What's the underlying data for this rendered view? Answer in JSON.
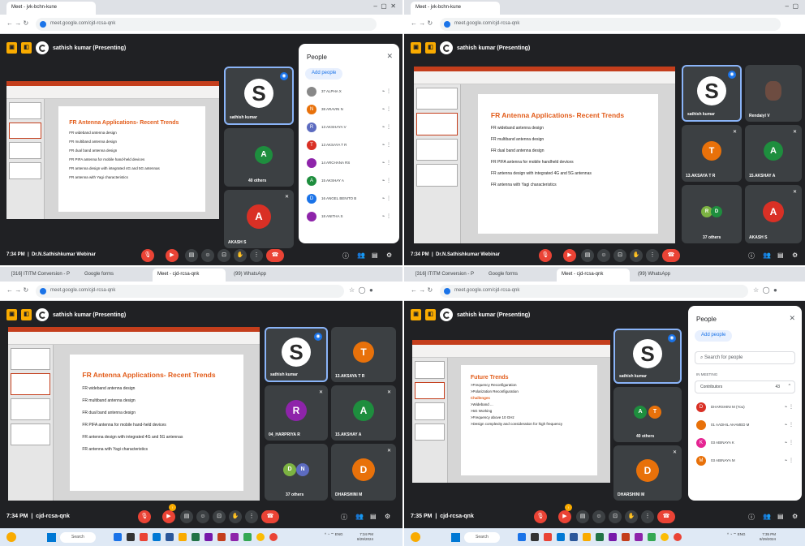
{
  "q1": {
    "tab": "Meet - jvk-bchn-kune",
    "url": "meet.google.com/cjd-rcsa-qnk",
    "presenter": "sathish kumar (Presenting)",
    "slide_title": "FR Antenna Applications- Recent Trends",
    "bullets": [
      "FR wideband antenna design",
      "FR multiband antenna design",
      "FR dual band antenna design",
      "FR PIFA antenna for mobile hand-held devices",
      "FR antenna design with integrated 4G and 5G antennas",
      "FR antenna with Yagi characteristics"
    ],
    "tiles": {
      "main": "sathish kumar",
      "others": "40 others",
      "akash": "AKASH S",
      "akash_initial": "A",
      "others_initial": "A"
    },
    "time": "7:34 PM",
    "meeting": "Dr.N.Sathishkumar Webinar",
    "people": {
      "title": "People",
      "add": "Add people",
      "rows": [
        {
          "name": "37 ALPHA X",
          "initial": "",
          "color": "#888888"
        },
        {
          "name": "38 ARAVIN N",
          "initial": "N",
          "color": "#e8710a"
        },
        {
          "name": "13 AKSHAYA V",
          "initial": "R",
          "color": "#5c6bc0"
        },
        {
          "name": "13 AKSAYA T R",
          "initial": "T",
          "color": "#d93025"
        },
        {
          "name": "14 ARCHANA RS",
          "initial": "",
          "color": "#8e24aa"
        },
        {
          "name": "15 AKSHAY A",
          "initial": "A",
          "color": "#1e8e3e"
        },
        {
          "name": "16 ANGEL BENITO B",
          "initial": "D",
          "color": "#1a73e8"
        },
        {
          "name": "18 ANITHA S",
          "initial": "",
          "color": "#8e24aa"
        }
      ]
    }
  },
  "q2": {
    "tab": "Meet - jvk-bchn-kune",
    "url": "meet.google.com/cjd-rcsa-qnk",
    "presenter": "sathish kumar (Presenting)",
    "slide_title": "FR Antenna Applications- Recent Trends",
    "bullets": [
      "FR wideband antenna design",
      "FR multiband antenna design",
      "FR dual band antenna design",
      "FR PIFA antenna for mobile handheld devices",
      "FR antenna design with integrated 4G and 5G antennas",
      "FR antenna with Yagi characteristics"
    ],
    "tiles": {
      "main": "sathish kumar",
      "t2": "Rendaiyl V",
      "t3": "13.AKSAYA T R",
      "t3i": "T",
      "t4": "15.AKSHAY A",
      "t4i": "A",
      "t5": "37 others",
      "t5a": "R",
      "t5b": "D",
      "t6": "AKASH S",
      "t6i": "A"
    },
    "time": "7:34 PM",
    "meeting": "Dr.N.Sathishkumar Webinar"
  },
  "q3": {
    "tabs": [
      "[316] ITITM Conversion - P",
      "Google forms",
      "Meet - cjd-rcsa-qnk",
      "(99) WhatsApp"
    ],
    "url": "meet.google.com/cjd-rcsa-qnk",
    "presenter": "sathish kumar (Presenting)",
    "slide_title": "FR Antenna Applications- Recent Trends",
    "bullets": [
      "FR wideband antenna design",
      "FR multiband antenna design",
      "FR dual band antenna design",
      "FR PIFA antenna for mobile hand-held devices",
      "FR antenna design with integrated 4G and 5G antennas",
      "FR antenna with Yagi characteristics"
    ],
    "tiles": {
      "main": "sathish kumar",
      "t2": "13.AKSAYA T R",
      "t2i": "T",
      "t3": "04_HARPRIYA R",
      "t3i": "R",
      "t4": "15.AKSHAY A",
      "t4i": "A",
      "t5": "37 others",
      "t5a": "D",
      "t5b": "N",
      "t6": "DHARSHINI M",
      "t6i": "D"
    },
    "time": "7:34 PM",
    "meeting": "cjd-rcsa-qnk",
    "search": "Search"
  },
  "q4": {
    "tabs": [
      "[316] ITITM Conversion - P",
      "Google forms",
      "Meet - cjd-rcsa-qnk",
      "(99) WhatsApp"
    ],
    "url": "meet.google.com/cjd-rcsa-qnk",
    "presenter": "sathish kumar (Presenting)",
    "slide_title": "Future Trends",
    "bullets": [
      ">Frequency Reconfiguration",
      ">Polarization Reconfiguration",
      "Challenges",
      ">Wideband ...",
      ">5G Working",
      ">Frequency above 10 GHz",
      ">Design complexity and consideration for high frequency"
    ],
    "tiles": {
      "main": "sathish kumar",
      "t2": "40 others",
      "t2a": "A",
      "t2b": "T",
      "t3": "DHARSHINI M",
      "t3i": "D"
    },
    "time": "7:35 PM",
    "meeting": "cjd-rcsa-qnk",
    "people": {
      "title": "People",
      "add": "Add people",
      "search": "Search for people",
      "in_meeting": "IN MEETING",
      "contributors": "Contributors",
      "count": "43",
      "rows": [
        {
          "name": "DHARSHINI M (You)",
          "initial": "D",
          "color": "#d93025"
        },
        {
          "name": "01 AADHIL AHAMED M",
          "initial": "",
          "color": "#e8710a"
        },
        {
          "name": "03 ABINAYA K",
          "initial": "K",
          "color": "#e52592"
        },
        {
          "name": "03 ABINAYA M",
          "initial": "M",
          "color": "#e8710a"
        }
      ]
    },
    "search": "Search"
  },
  "taskbar": {
    "search": "Search",
    "date1": "7:34 PM",
    "date2": "8/29/2024",
    "date3": "7:35 PM",
    "date4": "8/29/2024"
  },
  "colors": {
    "meet_bg": "#202124",
    "tile": "#3c4043",
    "accent": "#8ab4f8",
    "end": "#ea4335",
    "slide_title": "#e25c1a"
  }
}
